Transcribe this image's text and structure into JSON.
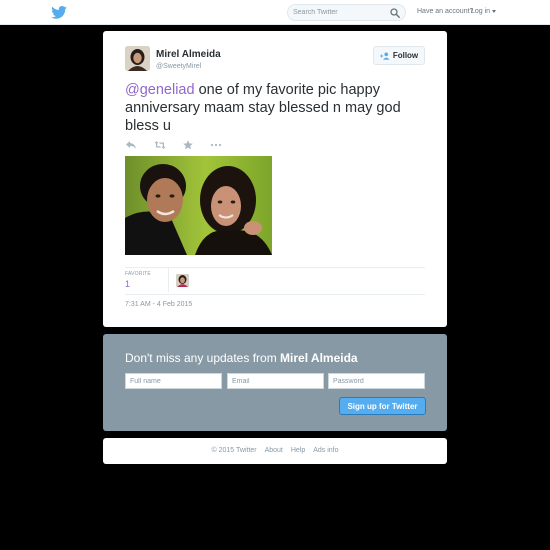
{
  "topbar": {
    "logo_icon": "twitter-bird-icon",
    "search_placeholder": "Search Twitter",
    "search_icon": "search-icon",
    "account_prompt": "Have an account?",
    "login_label": "Log in",
    "login_caret_icon": "caret-down-icon"
  },
  "tweet": {
    "display_name": "Mirel Almeida",
    "screen_name": "@SweetyMirel",
    "follow_label": "Follow",
    "follow_icon": "add-person-icon",
    "mention": "@geneliad",
    "text": " one of my favorite pic happy anniversary maam stay blessed n may god bless u",
    "action_icons": [
      "reply-icon",
      "retweet-icon",
      "favorite-star-icon",
      "more-dots-icon"
    ],
    "favorites_label": "FAVORITE",
    "favorites_count": "1",
    "timestamp": "7:31 AM - 4 Feb 2015"
  },
  "signup": {
    "heading_prefix": "Don't miss any updates from ",
    "heading_name": "Mirel Almeida",
    "fullname_placeholder": "Full name",
    "email_placeholder": "Email",
    "password_placeholder": "Password",
    "button_label": "Sign up for Twitter"
  },
  "footer": {
    "copyright": "© 2015 Twitter",
    "links": [
      "About",
      "Help",
      "Ads info"
    ]
  },
  "colors": {
    "brand_blue": "#55acee",
    "link_purple": "#9266cc",
    "signup_bg": "#8899a6",
    "page_bg": "#000000"
  }
}
